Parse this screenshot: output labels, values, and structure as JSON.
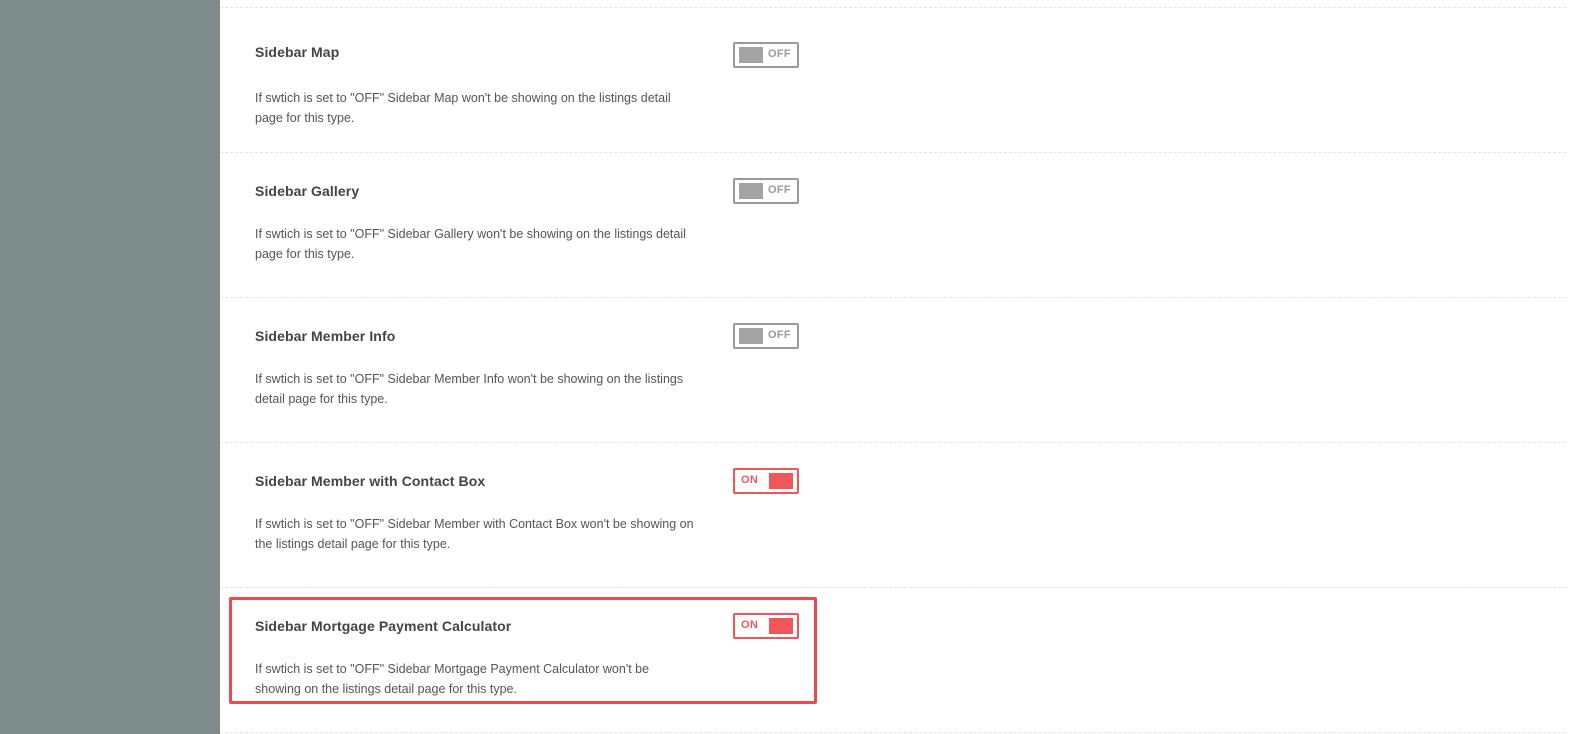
{
  "settings": [
    {
      "title": "Sidebar Map",
      "description": "If swtich is set to \"OFF\" Sidebar Map won't be showing on the listings detail page for this type.",
      "toggle_state": "OFF"
    },
    {
      "title": "Sidebar Gallery",
      "description": "If swtich is set to \"OFF\" Sidebar Gallery won't be showing on the listings detail page for this type.",
      "toggle_state": "OFF"
    },
    {
      "title": "Sidebar Member Info",
      "description": "If swtich is set to \"OFF\" Sidebar Member Info won't be showing on the listings detail page for this type.",
      "toggle_state": "OFF"
    },
    {
      "title": "Sidebar Member with Contact Box",
      "description": "If swtich is set to \"OFF\" Sidebar Member with Contact Box won't be showing on the listings detail page for this type.",
      "toggle_state": "ON"
    },
    {
      "title": "Sidebar Mortgage Payment Calculator",
      "description": "If swtich is set to \"OFF\" Sidebar Mortgage Payment Calculator won't be showing on the listings detail page for this type.",
      "toggle_state": "ON",
      "highlighted": true
    }
  ],
  "colors": {
    "sidebar_bg": "#7e8b8b",
    "toggle_on": "#f0565a",
    "toggle_off": "#a3a3a3",
    "highlight_border": "#ec4a4f"
  }
}
